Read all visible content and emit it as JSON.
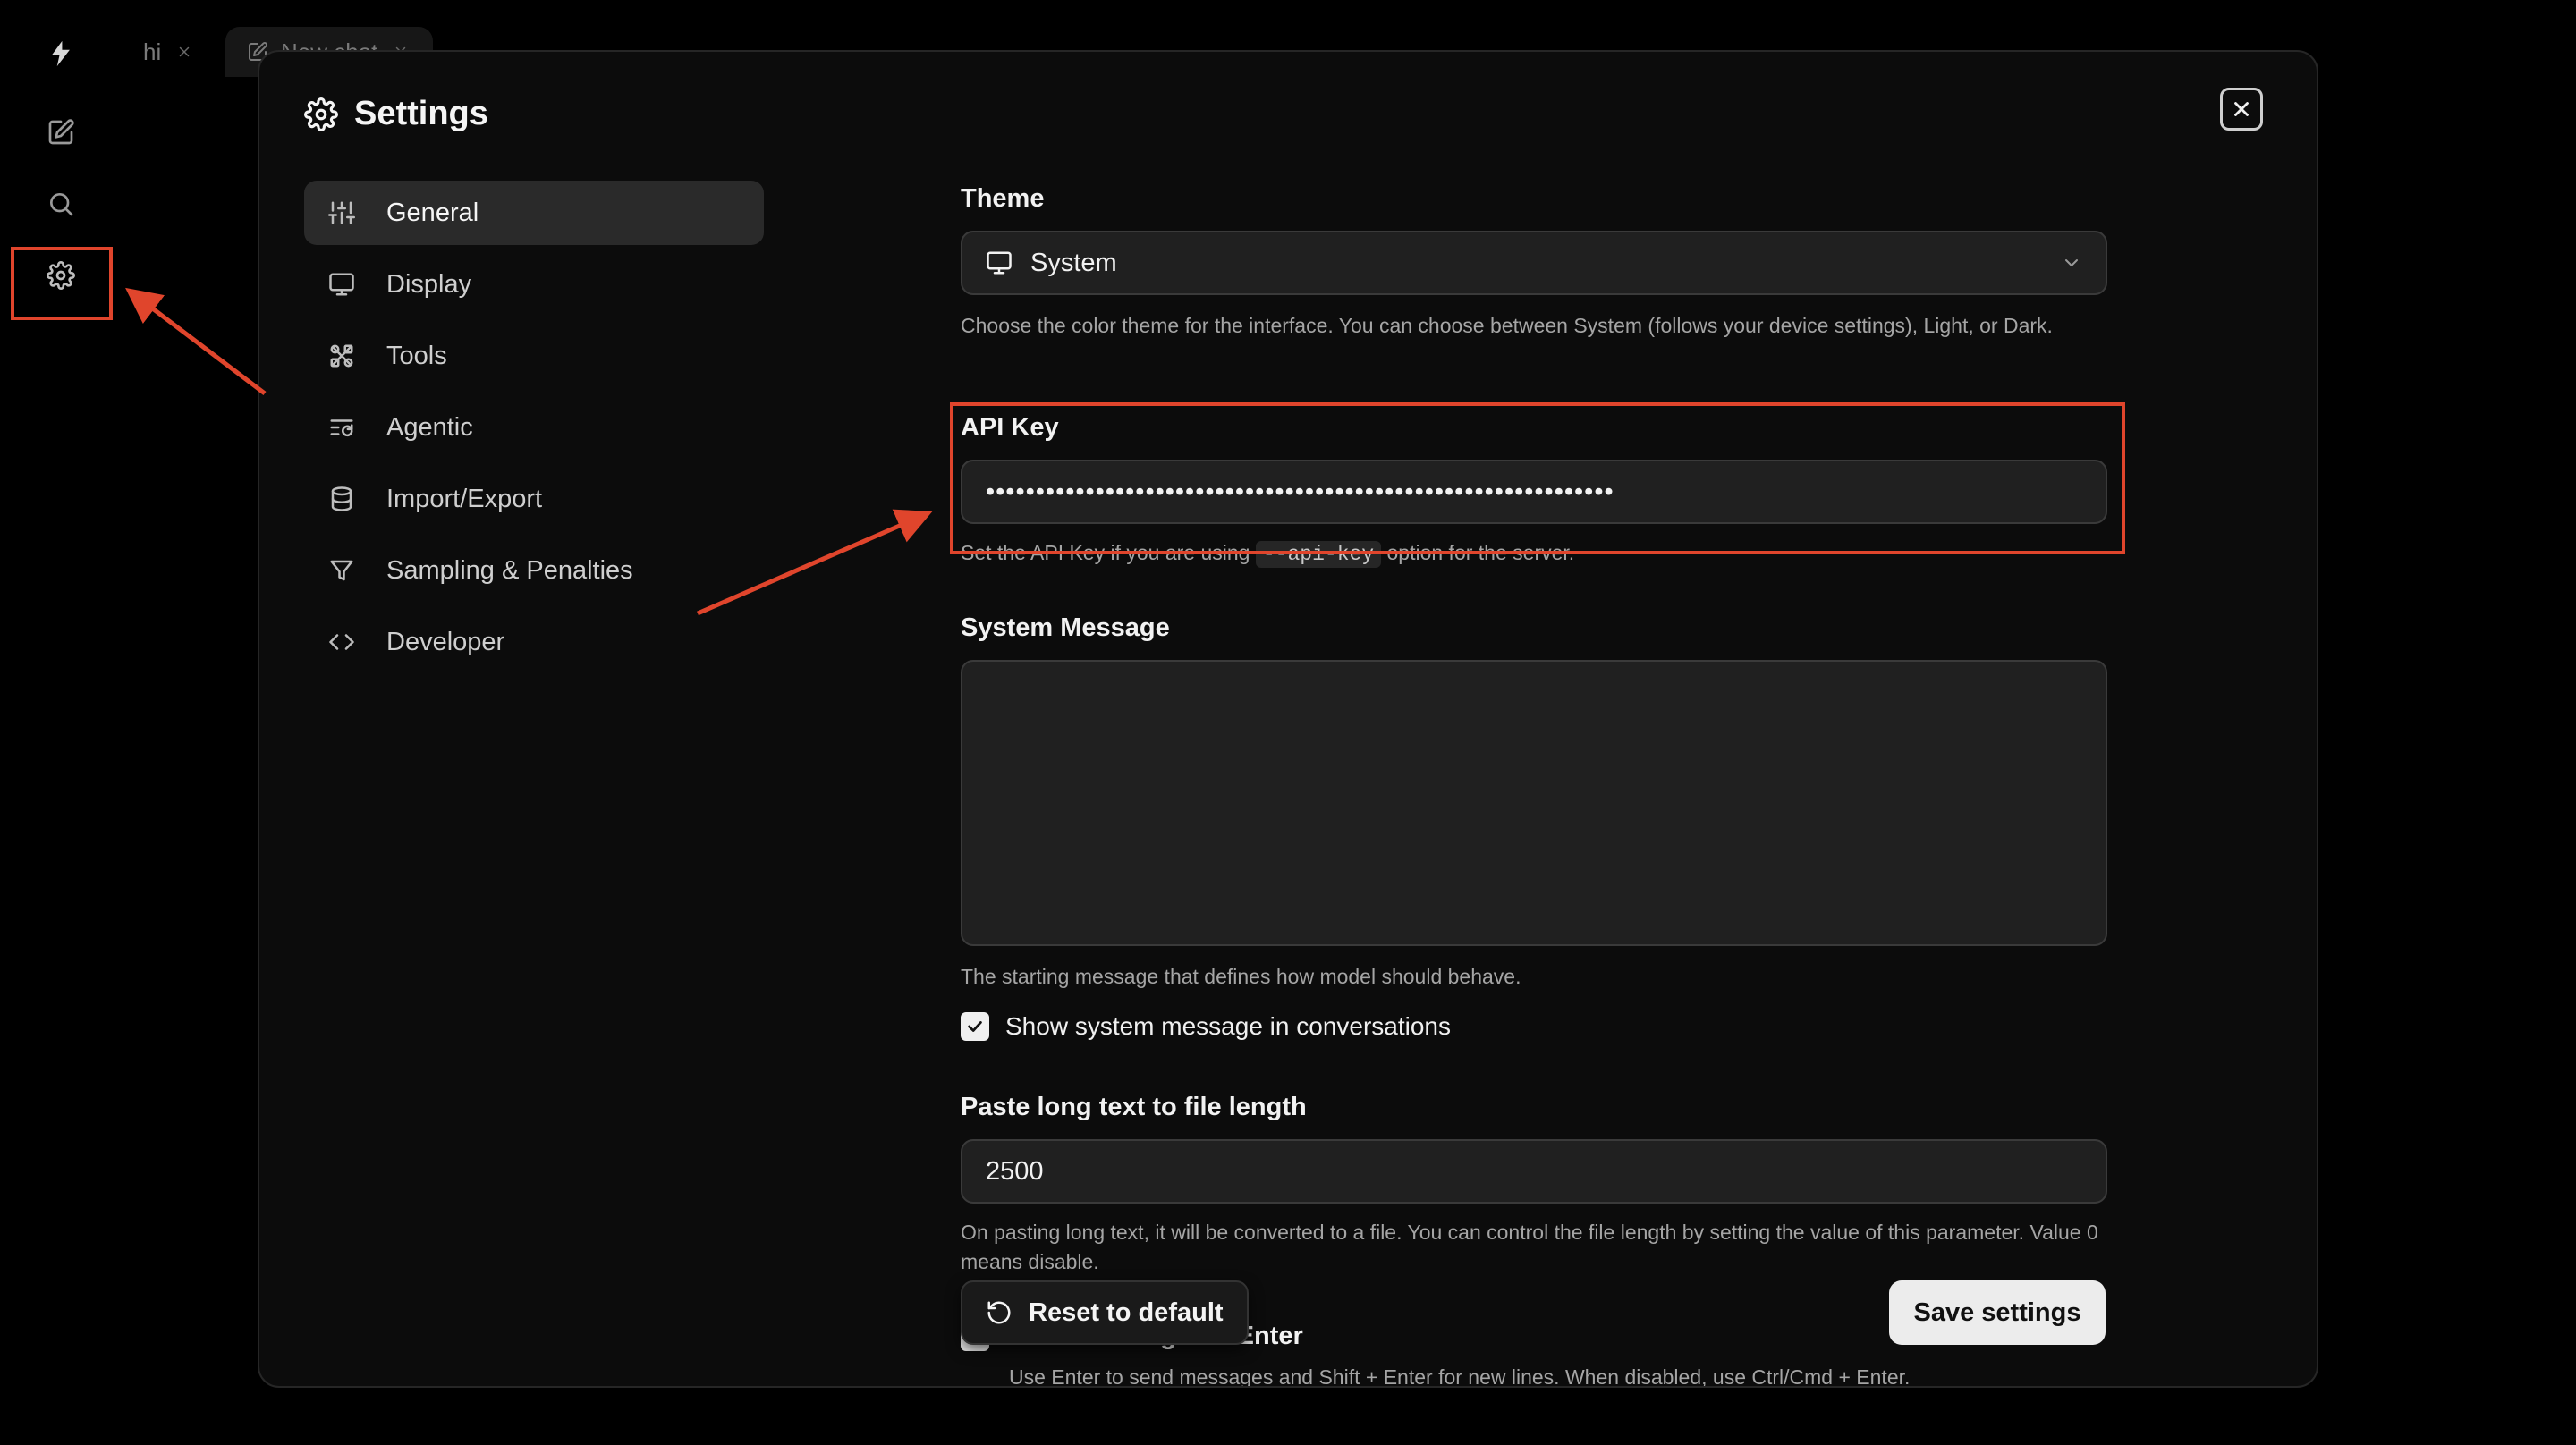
{
  "tabs": [
    {
      "label": "hi"
    },
    {
      "label": "New chat"
    }
  ],
  "dialog": {
    "title": "Settings",
    "nav": [
      {
        "label": "General",
        "icon": "sliders-icon",
        "active": true
      },
      {
        "label": "Display",
        "icon": "monitor-icon"
      },
      {
        "label": "Tools",
        "icon": "tools-icon"
      },
      {
        "label": "Agentic",
        "icon": "agentic-icon"
      },
      {
        "label": "Import/Export",
        "icon": "database-icon"
      },
      {
        "label": "Sampling & Penalties",
        "icon": "funnel-icon"
      },
      {
        "label": "Developer",
        "icon": "code-icon"
      }
    ]
  },
  "theme": {
    "label": "Theme",
    "value": "System",
    "help": "Choose the color theme for the interface. You can choose between System (follows your device settings), Light, or Dark."
  },
  "api_key": {
    "label": "API Key",
    "value": "•••••••••••••••••••••••••••••••••••••••••••••••••••••••••••••••",
    "help_pre": "Set the API Key if you are using",
    "help_code": "--api-key",
    "help_post": "option for the server."
  },
  "system_message": {
    "label": "System Message",
    "value": "",
    "help": "The starting message that defines how model should behave.",
    "show_label": "Show system message in conversations",
    "show_checked": true
  },
  "paste_length": {
    "label": "Paste long text to file length",
    "value": "2500",
    "help": "On pasting long text, it will be converted to a file. You can control the file length by setting the value of this parameter. Value 0 means disable."
  },
  "send_on_enter": {
    "label": "Send message on Enter",
    "help": "Use Enter to send messages and Shift + Enter for new lines. When disabled, use Ctrl/Cmd + Enter."
  },
  "buttons": {
    "reset": "Reset to default",
    "save": "Save settings"
  },
  "annotation_color": "#e0452c"
}
